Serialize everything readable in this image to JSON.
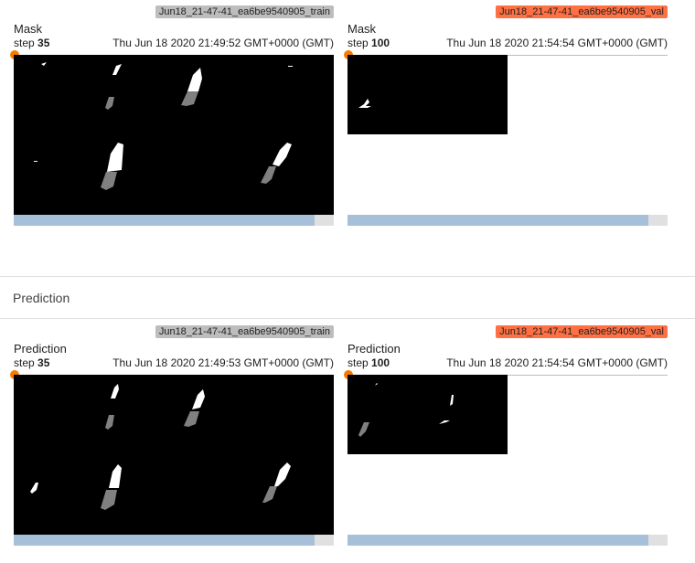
{
  "section_title": "Prediction",
  "colors": {
    "train_badge": "#bdbdbd",
    "val_badge": "#ff7043",
    "slider_knob": "#f57c00"
  },
  "cards": [
    {
      "title": "Mask",
      "step_label": "step",
      "step": "35",
      "time": "Thu Jun 18 2020 21:49:52 GMT+0000 (GMT)",
      "run": "Jun18_21-47-41_ea6be9540905_train"
    },
    {
      "title": "Mask",
      "step_label": "step",
      "step": "100",
      "time": "Thu Jun 18 2020 21:54:54 GMT+0000 (GMT)",
      "run": "Jun18_21-47-41_ea6be9540905_val"
    },
    {
      "title": "Prediction",
      "step_label": "step",
      "step": "35",
      "time": "Thu Jun 18 2020 21:49:53 GMT+0000 (GMT)",
      "run": "Jun18_21-47-41_ea6be9540905_train"
    },
    {
      "title": "Prediction",
      "step_label": "step",
      "step": "100",
      "time": "Thu Jun 18 2020 21:54:54 GMT+0000 (GMT)",
      "run": "Jun18_21-47-41_ea6be9540905_val"
    }
  ]
}
